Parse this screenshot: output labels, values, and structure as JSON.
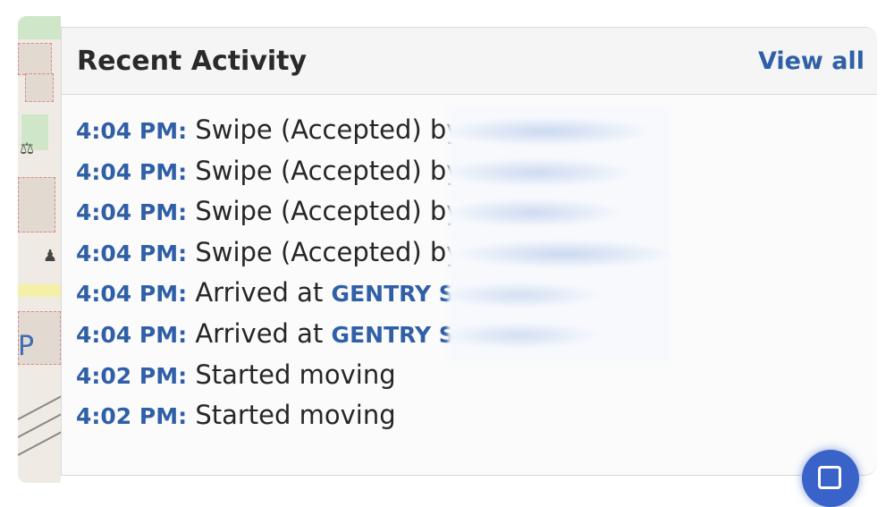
{
  "header": {
    "title": "Recent Activity",
    "view_all_label": "View all"
  },
  "activity": [
    {
      "time": "4:04 PM:",
      "text": "Swipe (Accepted) by",
      "link": ""
    },
    {
      "time": "4:04 PM:",
      "text": "Swipe (Accepted) by",
      "link": ""
    },
    {
      "time": "4:04 PM:",
      "text": "Swipe (Accepted) by",
      "link": ""
    },
    {
      "time": "4:04 PM:",
      "text": "Swipe (Accepted) by",
      "link": ""
    },
    {
      "time": "4:04 PM:",
      "text": "Arrived at",
      "link": "GENTRY ST"
    },
    {
      "time": "4:04 PM:",
      "text": "Arrived at",
      "link": "GENTRY ST"
    },
    {
      "time": "4:02 PM:",
      "text": "Started moving",
      "link": ""
    },
    {
      "time": "4:02 PM:",
      "text": "Started moving",
      "link": ""
    }
  ],
  "map": {
    "parking_label": "P"
  },
  "colors": {
    "accent": "#2f5fa7",
    "fab": "#3a63c9"
  }
}
